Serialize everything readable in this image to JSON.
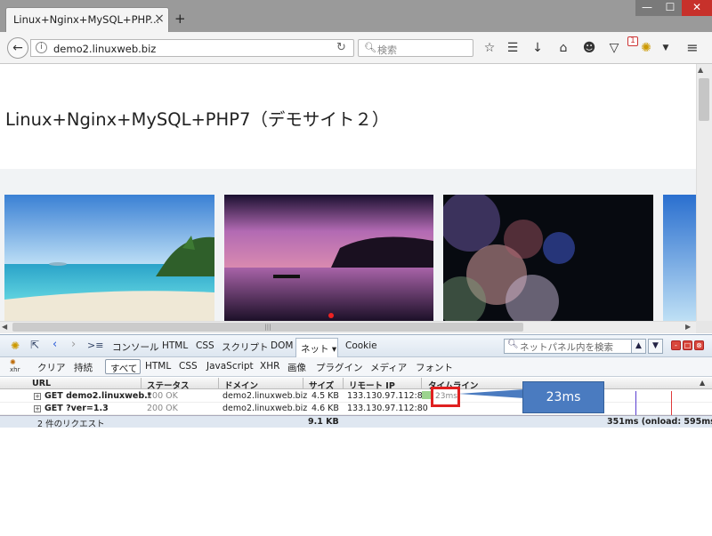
{
  "browser": {
    "tab_title": "Linux+Nginx+MySQL+PHP...",
    "tab_close": "×",
    "new_tab": "+",
    "window_controls": {
      "minimize": "—",
      "maximize": "☐",
      "close": "✕"
    },
    "url": "demo2.linuxweb.biz",
    "search_placeholder": "検索",
    "badge_count": "1"
  },
  "page": {
    "title": "Linux+Nginx+MySQL+PHP7（デモサイト２）"
  },
  "firebug": {
    "tabs": [
      "コンソール",
      "HTML",
      "CSS",
      "スクリプト",
      "DOM"
    ],
    "active_tab": "ネット ▾",
    "cookie_tab": "Cookie",
    "search_placeholder": "ネットパネル内を検索",
    "filter": {
      "clear": "クリア",
      "persist": "持続",
      "all": "すべて",
      "items": [
        "HTML",
        "CSS",
        "JavaScript",
        "XHR",
        "画像",
        "プラグイン",
        "メディア",
        "フォント"
      ]
    },
    "columns": {
      "url": "URL",
      "status": "ステータス",
      "domain": "ドメイン",
      "size": "サイズ",
      "remote_ip": "リモート IP",
      "timeline": "タイムライン"
    },
    "rows": [
      {
        "url": "GET demo2.linuxweb.t",
        "status": "200 OK",
        "domain": "demo2.linuxweb.biz",
        "size": "4.5 KB",
        "ip": "133.130.97.112:80"
      },
      {
        "url": "GET ?ver=1.3",
        "status": "200 OK",
        "domain": "demo2.linuxweb.biz",
        "size": "4.6 KB",
        "ip": "133.130.97.112:80"
      }
    ],
    "summary": {
      "count": "2 件のリクエスト",
      "size": "9.1 KB",
      "time": "351ms (onload: 595ms)"
    },
    "highlight_time": "23ms",
    "callout_text": "23ms",
    "xhr_label": "xhr"
  }
}
